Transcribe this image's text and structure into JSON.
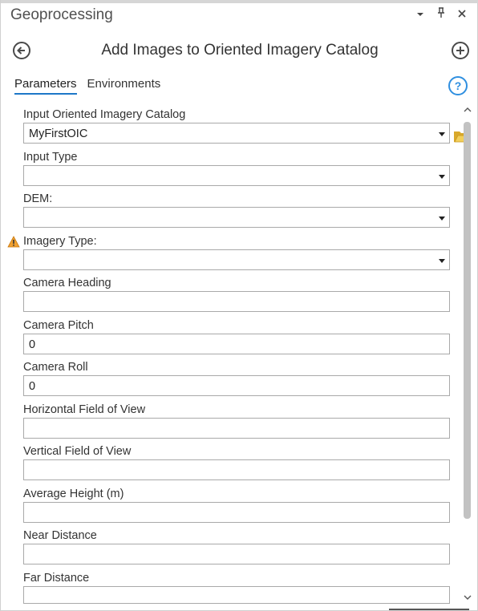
{
  "pane": {
    "title": "Geoprocessing"
  },
  "tool": {
    "title": "Add Images to Oriented Imagery Catalog"
  },
  "tabs": [
    {
      "label": "Parameters",
      "active": true
    },
    {
      "label": "Environments",
      "active": false
    }
  ],
  "help_label": "?",
  "fields": {
    "input_catalog": {
      "label": "Input Oriented Imagery Catalog",
      "value": "MyFirstOIC"
    },
    "input_type": {
      "label": "Input Type",
      "value": ""
    },
    "dem": {
      "label": "DEM:",
      "value": ""
    },
    "imagery_type": {
      "label": "Imagery Type:",
      "value": ""
    },
    "camera_heading": {
      "label": "Camera Heading",
      "value": ""
    },
    "camera_pitch": {
      "label": "Camera Pitch",
      "value": "0"
    },
    "camera_roll": {
      "label": "Camera Roll",
      "value": "0"
    },
    "hfov": {
      "label": "Horizontal Field of View",
      "value": ""
    },
    "vfov": {
      "label": "Vertical Field of View",
      "value": ""
    },
    "avg_height": {
      "label": "Average Height (m)",
      "value": ""
    },
    "near_distance": {
      "label": "Near Distance",
      "value": ""
    },
    "far_distance": {
      "label": "Far Distance",
      "value": ""
    }
  },
  "colors": {
    "accent": "#1e78c8",
    "help": "#2f8fe0",
    "warning": "#f0a030",
    "folder": "#e8c44a"
  }
}
